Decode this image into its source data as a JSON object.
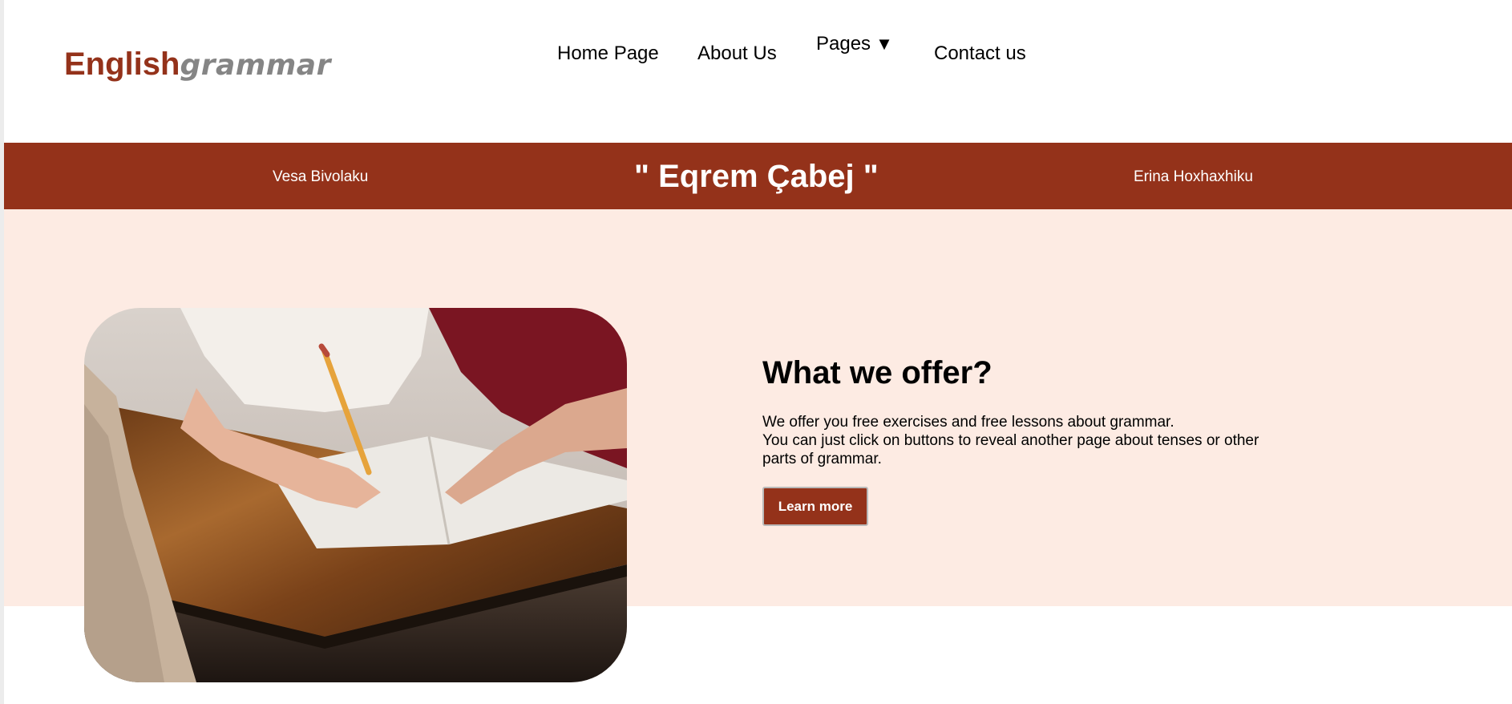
{
  "header": {
    "logo": {
      "part1": "English",
      "part2": "grammar"
    },
    "nav": {
      "home": "Home Page",
      "about": "About Us",
      "pages": "Pages",
      "contact": "Contact us"
    }
  },
  "banner": {
    "left_name": "Vesa Bivolaku",
    "title": "\" Eqrem Çabej \"",
    "right_name": "Erina Hoxhaxhiku"
  },
  "hero": {
    "title": "What we offer?",
    "text_line1": "We offer you free exercises and free lessons about grammar.",
    "text_line2": "You can just click on buttons to reveal another page about tenses or other",
    "text_line3": "parts of grammar.",
    "button_label": "Learn more"
  },
  "colors": {
    "brand_brown": "#94321a",
    "hero_background": "#fdebe3",
    "logo_gray": "#858585"
  },
  "icons": {
    "nav_dropdown": "caret-down-icon"
  }
}
